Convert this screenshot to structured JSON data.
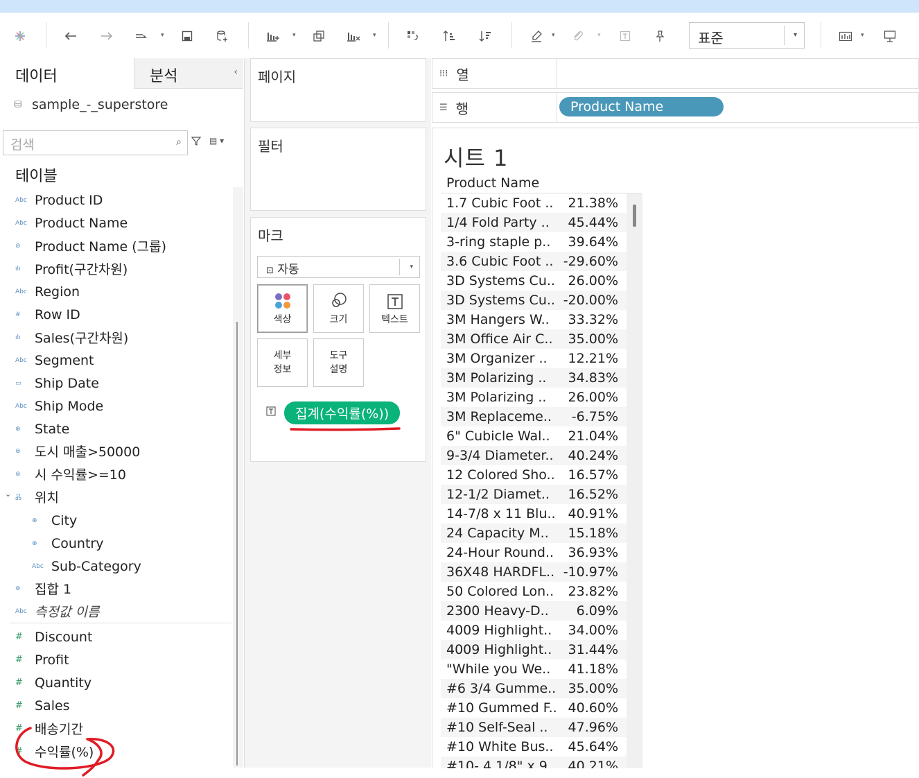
{
  "toolbar": {
    "fit_value": "표준",
    "icons": [
      "tableau-logo-icon",
      "undo-icon",
      "redo-icon",
      "replay-icon",
      "save-icon",
      "new-datasource-icon",
      "new-worksheet-icon",
      "duplicate-icon",
      "clear-sheet-icon",
      "swap-icon",
      "sort-ascending-icon",
      "sort-descending-icon",
      "highlight-icon",
      "group-icon",
      "label-icon",
      "pin-icon",
      "chart-icon",
      "presentation-icon"
    ]
  },
  "left": {
    "tab_data": "데이터",
    "tab_analysis": "분석",
    "collapse": "‹",
    "datasource": "sample_-_superstore",
    "search_placeholder": "검색",
    "section_title": "테이블",
    "fields": [
      {
        "icon": "Abc",
        "label": "Product ID"
      },
      {
        "icon": "Abc",
        "label": "Product Name"
      },
      {
        "icon": "⊘",
        "label": "Product Name (그룹)"
      },
      {
        "icon": "ılı",
        "label": "Profit(구간차원)"
      },
      {
        "icon": "Abc",
        "label": "Region"
      },
      {
        "icon": "#",
        "label": "Row ID"
      },
      {
        "icon": "ılı",
        "label": "Sales(구간차원)"
      },
      {
        "icon": "Abc",
        "label": "Segment"
      },
      {
        "icon": "▭",
        "label": "Ship Date"
      },
      {
        "icon": "Abc",
        "label": "Ship Mode"
      },
      {
        "icon": "⊕",
        "label": "State"
      },
      {
        "icon": "⊚",
        "label": "도시 매출>50000"
      },
      {
        "icon": "⊚",
        "label": "시 수익률>=10"
      },
      {
        "icon": "品",
        "label": "위치"
      },
      {
        "icon": "⊕",
        "label": "City"
      },
      {
        "icon": "⊕",
        "label": "Country"
      },
      {
        "icon": "Abc",
        "label": "Sub-Category"
      },
      {
        "icon": "⊚",
        "label": "집합 1"
      },
      {
        "icon": "Abc",
        "label": "측정값 이름"
      }
    ],
    "measures": [
      {
        "icon": "#",
        "label": "Discount"
      },
      {
        "icon": "#",
        "label": "Profit"
      },
      {
        "icon": "#",
        "label": "Quantity"
      },
      {
        "icon": "#",
        "label": "Sales"
      },
      {
        "icon": "#",
        "label": "배송기간"
      },
      {
        "icon": "#",
        "label": "수익률(%)"
      }
    ]
  },
  "cards": {
    "pages": "페이지",
    "filters": "필터",
    "marks": "마크",
    "mark_type": "자동",
    "mark_buttons": {
      "color": "색상",
      "size": "크기",
      "text": "텍스트",
      "detail": "세부\n정보",
      "tooltip": "도구\n설명"
    },
    "marks_pill": "집계(수익률(%))"
  },
  "shelves": {
    "columns_label": "열",
    "rows_label": "행",
    "rows_pill": "Product Name"
  },
  "view": {
    "sheet_title": "시트 1",
    "column_header": "Product Name",
    "rows": [
      {
        "name": "1.7 Cubic Foot ..",
        "value": "21.38%"
      },
      {
        "name": "1/4 Fold Party ..",
        "value": "45.44%"
      },
      {
        "name": "3-ring staple p..",
        "value": "39.64%"
      },
      {
        "name": "3.6 Cubic Foot ..",
        "value": "-29.60%"
      },
      {
        "name": "3D Systems Cu..",
        "value": "26.00%"
      },
      {
        "name": "3D Systems Cu..",
        "value": "-20.00%"
      },
      {
        "name": "3M Hangers W..",
        "value": "33.32%"
      },
      {
        "name": "3M Office Air C..",
        "value": "35.00%"
      },
      {
        "name": "3M Organizer ..",
        "value": "12.21%"
      },
      {
        "name": "3M Polarizing ..",
        "value": "34.83%"
      },
      {
        "name": "3M Polarizing ..",
        "value": "26.00%"
      },
      {
        "name": "3M Replaceme..",
        "value": "-6.75%"
      },
      {
        "name": "6\" Cubicle Wal..",
        "value": "21.04%"
      },
      {
        "name": "9-3/4 Diameter..",
        "value": "40.24%"
      },
      {
        "name": "12 Colored Sho..",
        "value": "16.57%"
      },
      {
        "name": "12-1/2 Diamet..",
        "value": "16.52%"
      },
      {
        "name": "14-7/8 x 11 Blu..",
        "value": "40.91%"
      },
      {
        "name": "24 Capacity M..",
        "value": "15.18%"
      },
      {
        "name": "24-Hour Round..",
        "value": "36.93%"
      },
      {
        "name": "36X48 HARDFL..",
        "value": "-10.97%"
      },
      {
        "name": "50 Colored Lon..",
        "value": "23.82%"
      },
      {
        "name": "2300 Heavy-D..",
        "value": "6.09%"
      },
      {
        "name": "4009 Highlight..",
        "value": "34.00%"
      },
      {
        "name": "4009 Highlight..",
        "value": "31.44%"
      },
      {
        "name": "\"While you We..",
        "value": "41.18%"
      },
      {
        "name": "#6 3/4 Gumme..",
        "value": "35.00%"
      },
      {
        "name": "#10 Gummed F..",
        "value": "40.60%"
      },
      {
        "name": "#10 Self-Seal ..",
        "value": "47.96%"
      },
      {
        "name": "#10 White Bus..",
        "value": "45.64%"
      },
      {
        "name": "#10- 4 1/8\" x 9..",
        "value": "40.21%"
      }
    ]
  },
  "colors": {
    "accent_green": "#0ab37a",
    "accent_blue": "#4a98b9",
    "annotation_red": "#e01b24"
  }
}
